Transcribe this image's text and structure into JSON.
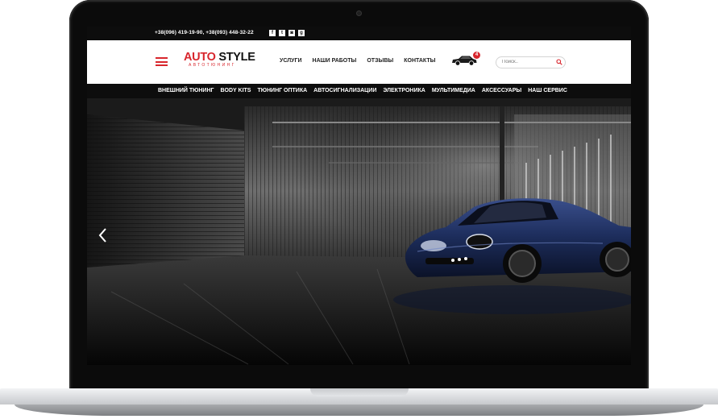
{
  "topbar": {
    "phones": "+38(096) 419-19-90, +38(093) 448-32-22",
    "socials": [
      {
        "icon": "facebook-icon",
        "glyph": "f"
      },
      {
        "icon": "twitter-icon",
        "glyph": "t"
      },
      {
        "icon": "instagram-icon",
        "glyph": "◙"
      },
      {
        "icon": "google-plus-icon",
        "glyph": "g"
      }
    ]
  },
  "header": {
    "logo_part1": "AUTO",
    "logo_part2": "STYLE",
    "logo_tagline": "АВТОТЮНИНГ",
    "nav": [
      "УСЛУГИ",
      "НАШИ РАБОТЫ",
      "ОТЗЫВЫ",
      "КОНТАКТЫ"
    ],
    "cart_count": "4",
    "search_placeholder": "Поиск.."
  },
  "categories": [
    "ВНЕШНИЙ ТЮНИНГ",
    "BODY KITS",
    "ТЮНИНГ ОПТИКА",
    "АВТОСИГНАЛИЗАЦИИ",
    "ЭЛЕКТРОНИКА",
    "МУЛЬТИМЕДИА",
    "АКСЕССУАРЫ",
    "НАШ СЕРВИС"
  ],
  "colors": {
    "accent": "#d8262d",
    "dark": "#0d0d0d",
    "car_blue": "#1c2c5a"
  }
}
